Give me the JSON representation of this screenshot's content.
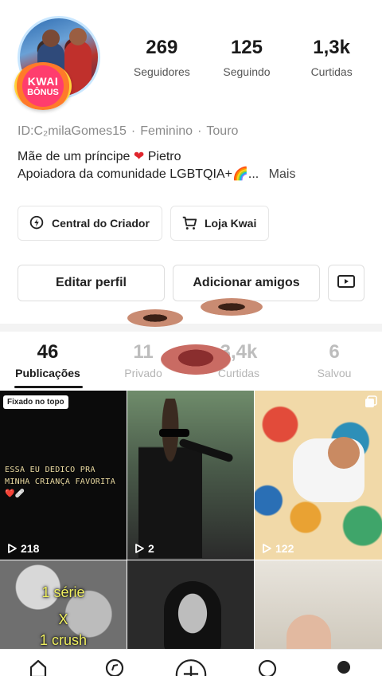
{
  "profile": {
    "badge_line1": "KWAI",
    "badge_line2": "BÔNUS",
    "id_line": "ID:C₂milaGomes15",
    "gender": "Feminino",
    "sign": "Touro",
    "separator": "·",
    "bio_line1_before": "Mãe de um príncipe",
    "bio_line1_after": "Pietro",
    "bio_line2": "Apoiadora da comunidade LGBTQIA+🌈...",
    "bio_more": "Mais"
  },
  "stats": [
    {
      "value": "269",
      "label": "Seguidores"
    },
    {
      "value": "125",
      "label": "Seguindo"
    },
    {
      "value": "1,3k",
      "label": "Curtidas"
    }
  ],
  "actions": {
    "creator_center": "Central do Criador",
    "shop": "Loja Kwai",
    "edit_profile": "Editar perfil",
    "add_friends": "Adicionar amigos"
  },
  "tabs": [
    {
      "count": "46",
      "label": "Publicações",
      "active": true
    },
    {
      "count": "11",
      "label": "Privado",
      "active": false
    },
    {
      "count": "3,4k",
      "label": "Curtidas",
      "active": false
    },
    {
      "count": "6",
      "label": "Salvou",
      "active": false
    }
  ],
  "grid": {
    "pinned_label": "Fixado no topo",
    "post1_caption": "ESSA EU DEDICO PRA MINHA CRIANÇA FAVORITA ❤️🩹",
    "post1_views": "218",
    "post2_views": "2",
    "post3_views": "122",
    "post4_line1": "1 série",
    "post4_line2": "X",
    "post4_line3": "1 crush"
  },
  "colors": {
    "accent_heart": "#e0262d",
    "badge": "#ff3d6e",
    "text_muted": "#8a8a8a"
  },
  "icons": [
    "lightbulb-icon",
    "cart-icon",
    "video-icon",
    "play-icon",
    "multi-photo-icon",
    "home-icon",
    "discover-icon",
    "create-icon",
    "messages-icon",
    "profile-icon"
  ]
}
